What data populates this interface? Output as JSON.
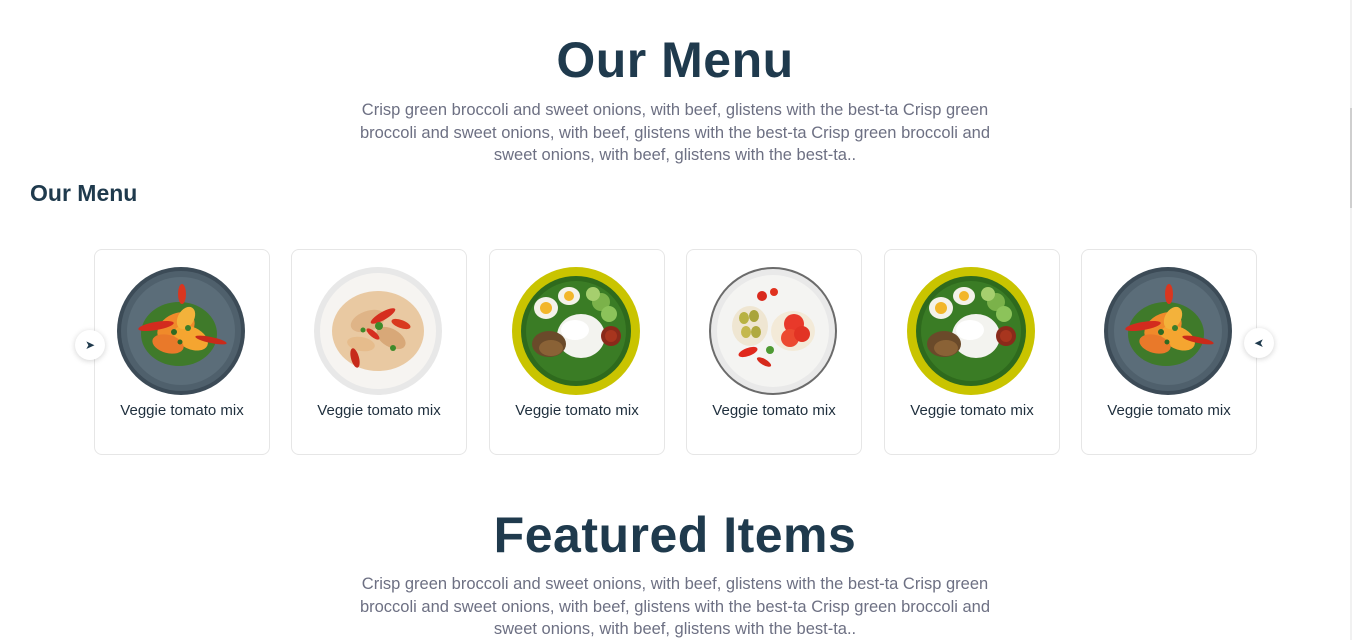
{
  "menu_section": {
    "title": "Our Menu",
    "description": "Crisp green broccoli and sweet onions, with beef, glistens with the best-ta Crisp green broccoli and sweet onions, with beef, glistens with the best-ta Crisp green broccoli and sweet onions, with beef, glistens with the best-ta..",
    "sub_heading": "Our Menu"
  },
  "carousel": {
    "prev_icon": "arrow-right-icon",
    "next_icon": "arrow-left-icon",
    "prev_glyph": "➤",
    "next_glyph": "➤",
    "items": [
      {
        "label": "Veggie tomato mix",
        "image": "grilled-vegetables-dark-plate"
      },
      {
        "label": "Veggie tomato mix",
        "image": "spicy-noodles-white-plate"
      },
      {
        "label": "Veggie tomato mix",
        "image": "rice-egg-yellow-plate"
      },
      {
        "label": "Veggie tomato mix",
        "image": "tomato-salad-white-plate"
      },
      {
        "label": "Veggie tomato mix",
        "image": "rice-egg-yellow-plate"
      },
      {
        "label": "Veggie tomato mix",
        "image": "grilled-vegetables-dark-plate"
      }
    ]
  },
  "featured_section": {
    "title": "Featured Items",
    "description": "Crisp green broccoli and sweet onions, with beef, glistens with the best-ta Crisp green broccoli and sweet onions, with beef, glistens with the best-ta Crisp green broccoli and sweet onions, with beef, glistens with the best-ta.."
  },
  "colors": {
    "heading": "#1f3a4d",
    "body_text": "#6d7083",
    "card_border": "#e6e6e6"
  }
}
